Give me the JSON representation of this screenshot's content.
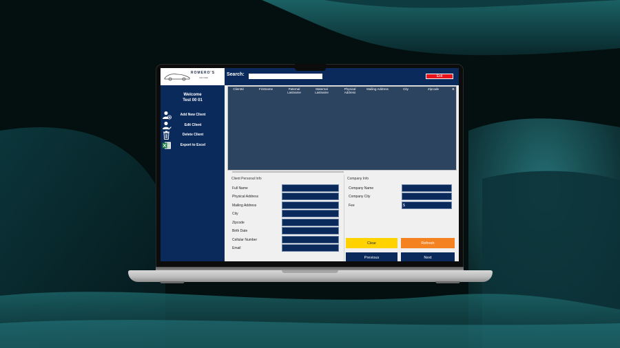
{
  "app": {
    "logo": {
      "brand": "ROMERO'S",
      "tagline": "CAR CARE"
    },
    "search": {
      "label": "Search:",
      "value": ""
    },
    "exit_label": "Exit",
    "sidebar": {
      "welcome_line1": "Welcome",
      "welcome_line2": "Test 00 01",
      "items": [
        {
          "label": "Add New Client",
          "icon": "add-user-icon"
        },
        {
          "label": "Edit Client",
          "icon": "edit-user-icon"
        },
        {
          "label": "Delete Client",
          "icon": "trash-icon"
        },
        {
          "label": "Export to Excel",
          "icon": "excel-icon"
        }
      ]
    },
    "grid": {
      "columns": [
        "ClientId",
        "Firstname",
        "Paternal Lastname",
        "Maternal Lastname",
        "Physical Address",
        "Mailing Address",
        "City",
        "Zipcode",
        "B"
      ],
      "rows": []
    },
    "personal_info": {
      "title": "Client Personal Info",
      "fields": [
        {
          "label": "Full Name",
          "value": ""
        },
        {
          "label": "Physical Address",
          "value": ""
        },
        {
          "label": "Mailing Address",
          "value": ""
        },
        {
          "label": "City",
          "value": ""
        },
        {
          "label": "Zipcode",
          "value": ""
        },
        {
          "label": "Birth Date",
          "value": ""
        },
        {
          "label": "Cellular Number",
          "value": ""
        },
        {
          "label": "Email",
          "value": ""
        }
      ]
    },
    "company_info": {
      "title": "Company Info",
      "fields": [
        {
          "label": "Company Name",
          "value": ""
        },
        {
          "label": "Company City",
          "value": ""
        },
        {
          "label": "Fee",
          "value": "$"
        }
      ]
    },
    "buttons": {
      "clear": "Clear",
      "refresh": "Refresh",
      "previous": "Previous",
      "next": "Next"
    }
  },
  "colors": {
    "navy": "#0b2a5c",
    "grid_bg": "#2d4461",
    "exit_red": "#e8141b",
    "clear_yellow": "#ffd200",
    "refresh_orange": "#f58220"
  }
}
